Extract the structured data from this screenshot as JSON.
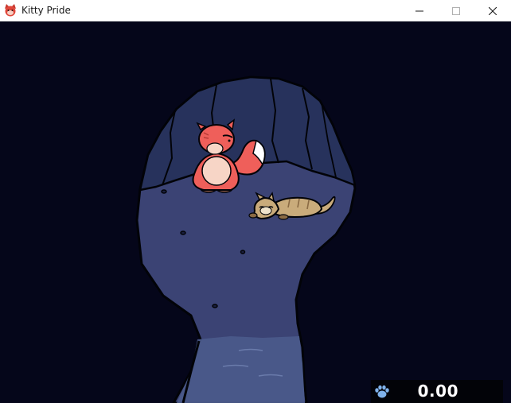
{
  "window": {
    "title": "Kitty Pride",
    "app_icon": "cat-face-icon",
    "controls": {
      "minimize": "minimize-icon",
      "maximize": "maximize-icon",
      "close": "close-icon"
    }
  },
  "scene": {
    "characters": [
      {
        "name": "red-fox-character",
        "state": "sitting",
        "color": "#ef5f5a"
      },
      {
        "name": "brown-cat-character",
        "state": "lying-down",
        "color": "#c9ab7b"
      }
    ],
    "colors": {
      "background": "#05061a",
      "cave_wall": "#27325c",
      "cave_floor": "#3b4374",
      "water": "#4a5a8a"
    }
  },
  "hud": {
    "icon": "paw-print-icon",
    "icon_color": "#7fb2ea",
    "value": "0.00"
  }
}
